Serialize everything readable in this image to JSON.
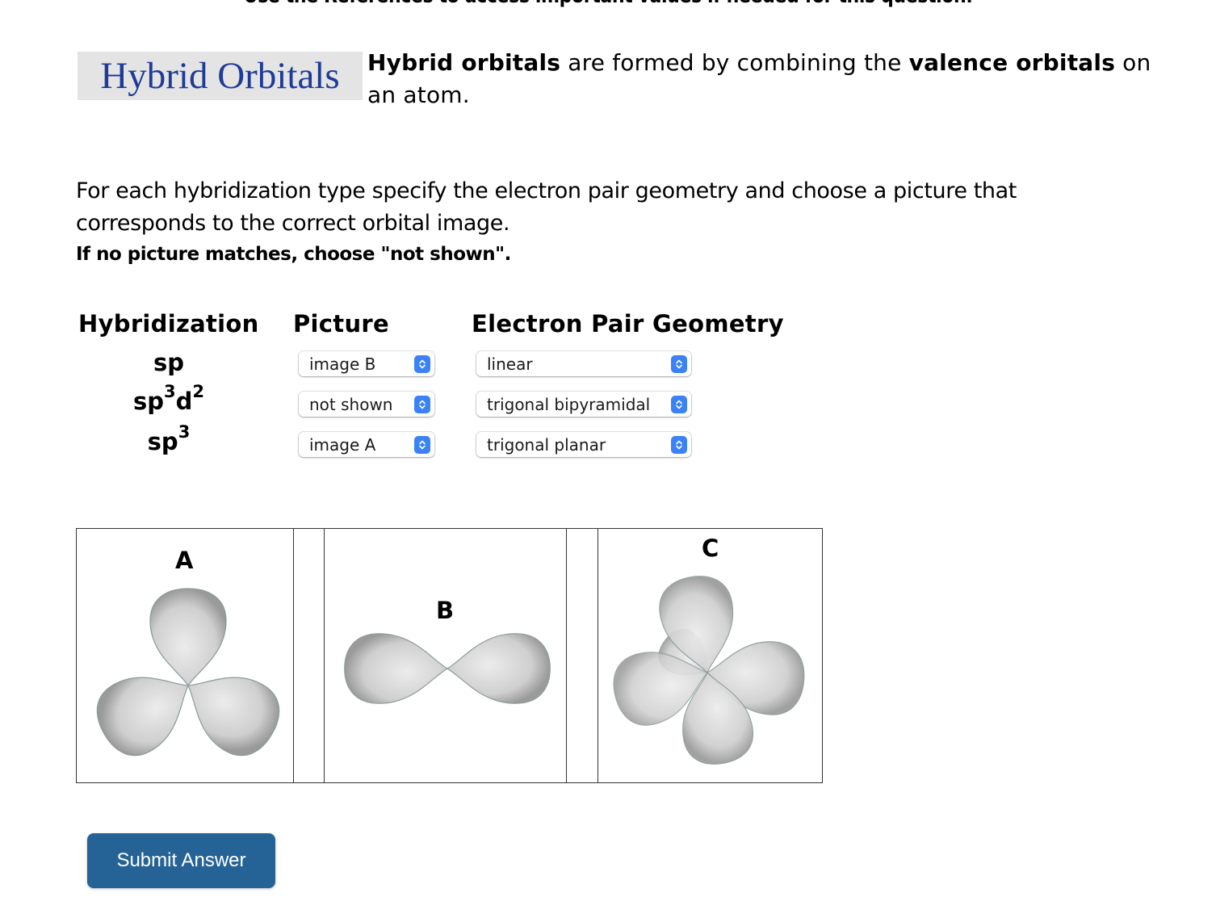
{
  "banner": "Use the References to access important values if needed for this question.",
  "logo": {
    "text": "Hybrid Orbitals"
  },
  "intro": {
    "bold1": "Hybrid orbitals",
    "text1": " are formed by combining the ",
    "bold2": "valence orbitals",
    "text2": " on an atom."
  },
  "instructions": "For each hybridization type specify the electron pair geometry and choose a picture that corresponds to the correct orbital image.",
  "note": "If no picture matches, choose \"not shown\".",
  "table": {
    "headers": {
      "hybridization": "Hybridization",
      "picture": "Picture",
      "geometry": "Electron Pair Geometry"
    },
    "rows": [
      {
        "hyb_base": "sp",
        "sup1": "",
        "mid": "",
        "sup2": "",
        "picture": "image B",
        "geometry": "linear"
      },
      {
        "hyb_base": "sp",
        "sup1": "3",
        "mid": "d",
        "sup2": "2",
        "picture": "not shown",
        "geometry": "trigonal bipyramidal"
      },
      {
        "hyb_base": "sp",
        "sup1": "3",
        "mid": "",
        "sup2": "",
        "picture": "image A",
        "geometry": "trigonal planar"
      }
    ]
  },
  "images": [
    {
      "label": "A",
      "description": "trigonal planar orbitals"
    },
    {
      "label": "B",
      "description": "linear orbitals"
    },
    {
      "label": "C",
      "description": "tetrahedral-like orbitals"
    }
  ],
  "colors": {
    "logo_text": "#1e3c97",
    "logo_bg": "#e4e4e4",
    "stepper": "#3a82f6",
    "submit_bg": "#256295",
    "lobe_fill": "#d4d4d4"
  },
  "submit": {
    "label": "Submit Answer"
  }
}
